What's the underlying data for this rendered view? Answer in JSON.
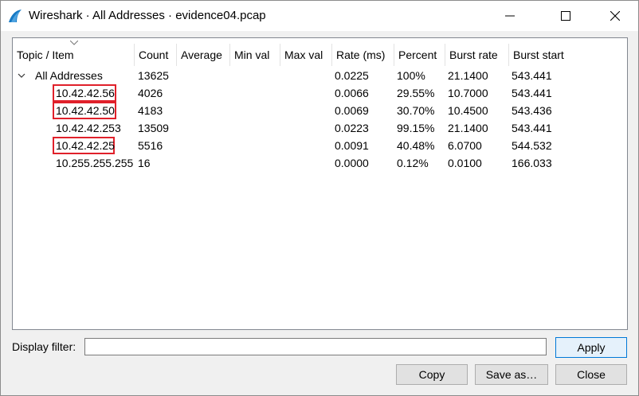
{
  "window": {
    "title": "Wireshark · All Addresses · evidence04.pcap"
  },
  "table": {
    "columns": [
      "Topic / Item",
      "Count",
      "Average",
      "Min val",
      "Max val",
      "Rate (ms)",
      "Percent",
      "Burst rate",
      "Burst start"
    ],
    "group": {
      "item": "All Addresses",
      "count": "13625",
      "rate": "0.0225",
      "percent": "100%",
      "burst_rate": "21.1400",
      "burst_start": "543.441"
    },
    "rows": [
      {
        "item": "10.42.42.56",
        "count": "4026",
        "rate": "0.0066",
        "percent": "29.55%",
        "burst_rate": "10.7000",
        "burst_start": "543.441",
        "highlighted": true
      },
      {
        "item": "10.42.42.50",
        "count": "4183",
        "rate": "0.0069",
        "percent": "30.70%",
        "burst_rate": "10.4500",
        "burst_start": "543.436",
        "highlighted": true
      },
      {
        "item": "10.42.42.253",
        "count": "13509",
        "rate": "0.0223",
        "percent": "99.15%",
        "burst_rate": "21.1400",
        "burst_start": "543.441",
        "highlighted": false
      },
      {
        "item": "10.42.42.25",
        "count": "5516",
        "rate": "0.0091",
        "percent": "40.48%",
        "burst_rate": "6.0700",
        "burst_start": "544.532",
        "highlighted": true
      },
      {
        "item": "10.255.255.255",
        "count": "16",
        "rate": "0.0000",
        "percent": "0.12%",
        "burst_rate": "0.0100",
        "burst_start": "166.033",
        "highlighted": false
      }
    ]
  },
  "filter": {
    "label": "Display filter:",
    "value": ""
  },
  "buttons": {
    "apply": "Apply",
    "copy": "Copy",
    "save_as": "Save as…",
    "close": "Close"
  },
  "colors": {
    "highlight_border": "#e0202a",
    "apply_border": "#0078d7"
  }
}
